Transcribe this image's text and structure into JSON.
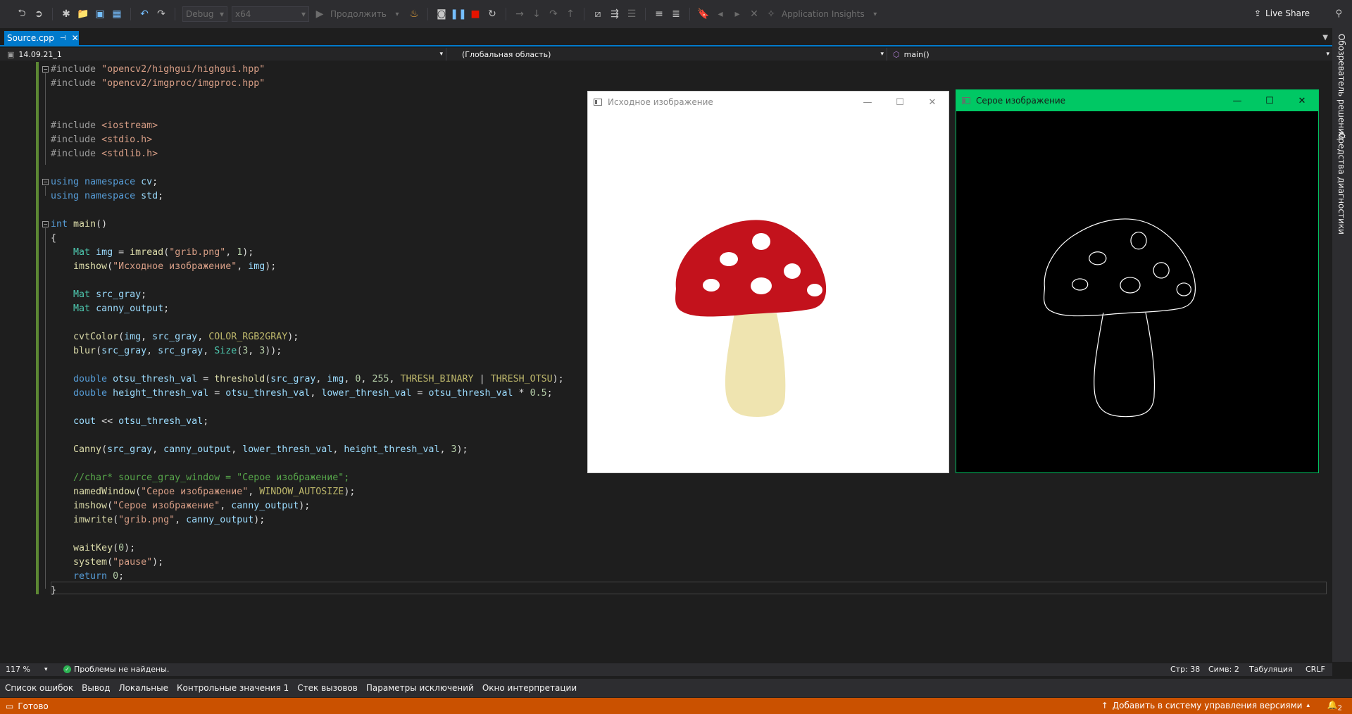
{
  "toolbar": {
    "config": "Debug",
    "platform": "x64",
    "continue_label": "Продолжить",
    "app_insights": "Application Insights",
    "live_share": "Live Share"
  },
  "tab": {
    "label": "Source.cpp"
  },
  "navbar": {
    "project": "14.09.21_1",
    "scope": "(Глобальная область)",
    "member": "main()"
  },
  "right_panel": {
    "item1": "Обозреватель решений",
    "item2": "Средства диагностики"
  },
  "code_lines": [
    "#include \"opencv2/highgui/highgui.hpp\"",
    "#include \"opencv2/imgproc/imgproc.hpp\"",
    "",
    "",
    "#include <iostream>",
    "#include <stdio.h>",
    "#include <stdlib.h>",
    "",
    "using namespace cv;",
    "using namespace std;",
    "",
    "int main()",
    "{",
    "    Mat img = imread(\"grib.png\", 1);",
    "    imshow(\"Исходное изображение\", img);",
    "",
    "    Mat src_gray;",
    "    Mat canny_output;",
    "",
    "    cvtColor(img, src_gray, COLOR_RGB2GRAY);",
    "    blur(src_gray, src_gray, Size(3, 3));",
    "",
    "    double otsu_thresh_val = threshold(src_gray, img, 0, 255, THRESH_BINARY | THRESH_OTSU);",
    "    double height_thresh_val = otsu_thresh_val, lower_thresh_val = otsu_thresh_val * 0.5;",
    "",
    "    cout << otsu_thresh_val;",
    "",
    "    Canny(src_gray, canny_output, lower_thresh_val, height_thresh_val, 3);",
    "",
    "    //char* source_gray_window = \"Серое изображение\";",
    "    namedWindow(\"Серое изображение\", WINDOW_AUTOSIZE);",
    "    imshow(\"Серое изображение\", canny_output);",
    "    imwrite(\"grib.png\", canny_output);",
    "",
    "    waitKey(0);",
    "    system(\"pause\");",
    "    return 0;",
    "}"
  ],
  "window_original": {
    "title": "Исходное изображение"
  },
  "window_gray": {
    "title": "Серое изображение"
  },
  "infobar": {
    "zoom": "117 %",
    "problems": "Проблемы не найдены.",
    "line": "Стр: 38",
    "col": "Симв: 2",
    "indent": "Табуляция",
    "eol": "CRLF"
  },
  "bottom_tabs": [
    "Список ошибок",
    "Вывод",
    "Локальные",
    "Контрольные значения 1",
    "Стек вызовов",
    "Параметры исключений",
    "Окно интерпретации"
  ],
  "statusbar": {
    "ready": "Готово",
    "source_control": "Добавить в систему управления версиями",
    "notif_count": "2"
  },
  "colors": {
    "accent": "#007acc",
    "status_orange": "#ca5100",
    "gray_window_title": "#00c864",
    "mushroom_cap": "#c3121c",
    "mushroom_stem": "#efe4b0"
  }
}
